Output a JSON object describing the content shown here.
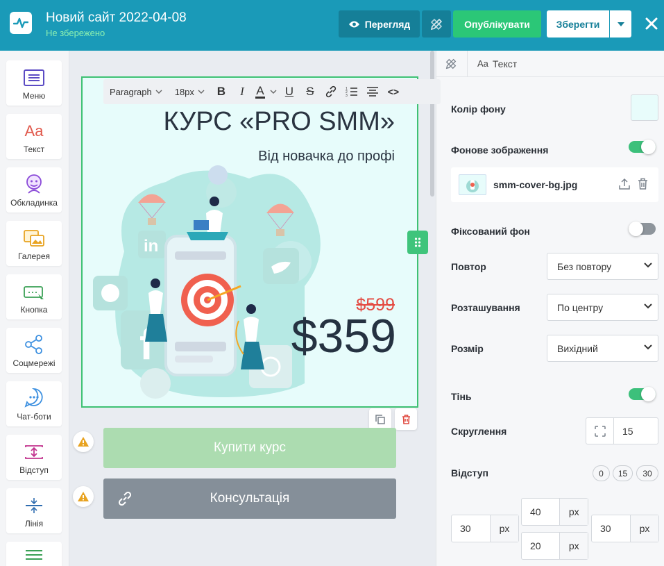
{
  "header": {
    "title": "Новий сайт 2022-04-08",
    "save_status": "Не збережено",
    "preview_label": "Перегляд",
    "publish_label": "Опублікувати",
    "save_label": "Зберегти"
  },
  "sidebar": {
    "items": [
      {
        "label": "Меню",
        "icon": "menu-icon"
      },
      {
        "label": "Текст",
        "icon": "text-icon"
      },
      {
        "label": "Обкладинка",
        "icon": "cover-icon"
      },
      {
        "label": "Галерея",
        "icon": "gallery-icon"
      },
      {
        "label": "Кнопка",
        "icon": "button-icon"
      },
      {
        "label": "Соцмережі",
        "icon": "share-icon"
      },
      {
        "label": "Чат-боти",
        "icon": "chat-icon"
      },
      {
        "label": "Відступ",
        "icon": "spacing-icon"
      },
      {
        "label": "Лінія",
        "icon": "divider-icon"
      }
    ]
  },
  "toolbar": {
    "paragraph": "Paragraph",
    "font_size": "18px",
    "bold": "B",
    "italic": "I",
    "color": "A",
    "underline": "U",
    "strike": "S",
    "code": "<>"
  },
  "cover": {
    "title": "КУРС «PRO SMM»",
    "subtitle": "Від новачка до профі",
    "old_price": "$599",
    "new_price": "$359"
  },
  "buttons": {
    "buy": "Купити курс",
    "consult": "Консультація"
  },
  "panel": {
    "breadcrumb_prefix": "Aa",
    "breadcrumb": "Текст",
    "bg_color_label": "Колір фону",
    "bg_color": "#e8fcfb",
    "bg_image_label": "Фонове зображення",
    "bg_image_enabled": true,
    "file_name": "smm-cover-bg.jpg",
    "fixed_bg_label": "Фіксований фон",
    "fixed_bg_enabled": false,
    "repeat_label": "Повтор",
    "repeat_value": "Без повтору",
    "position_label": "Розташування",
    "position_value": "По центру",
    "size_label": "Розмір",
    "size_value": "Вихідний",
    "shadow_label": "Тінь",
    "shadow_enabled": true,
    "radius_label": "Скруглення",
    "radius_value": "15",
    "padding_label": "Відступ",
    "padding_presets": [
      "0",
      "15",
      "30"
    ],
    "padding": {
      "top": "40",
      "left": "30",
      "right": "30",
      "bottom": "20",
      "unit": "px"
    }
  },
  "colors": {
    "header": "#1a9ab8",
    "accent_green": "#2bc777",
    "price_red": "#e44a41"
  }
}
